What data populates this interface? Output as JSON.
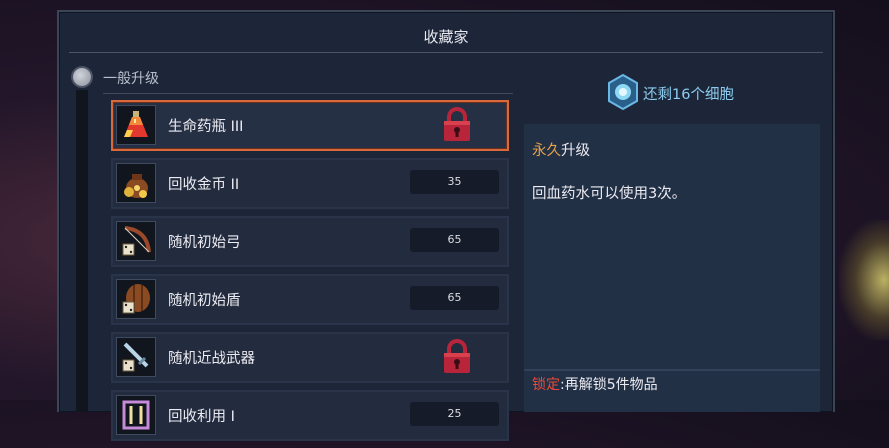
{
  "window": {
    "title": "收藏家"
  },
  "section": {
    "label": "一般升级"
  },
  "items": [
    {
      "name": "生命药瓶 III",
      "icon": "health-flask-icon",
      "locked": true,
      "cost": null,
      "selected": true
    },
    {
      "name": "回收金币 II",
      "icon": "gold-bag-icon",
      "locked": false,
      "cost": "35",
      "selected": false
    },
    {
      "name": "随机初始弓",
      "icon": "bow-dice-icon",
      "locked": false,
      "cost": "65",
      "selected": false
    },
    {
      "name": "随机初始盾",
      "icon": "shield-dice-icon",
      "locked": false,
      "cost": "65",
      "selected": false
    },
    {
      "name": "随机近战武器",
      "icon": "sword-dice-icon",
      "locked": true,
      "cost": null,
      "selected": false
    },
    {
      "name": "回收利用 I",
      "icon": "recycle-icon",
      "locked": false,
      "cost": "25",
      "selected": false
    }
  ],
  "cells": {
    "text": "还剩16个细胞",
    "icon": "cell-icon"
  },
  "detail": {
    "permanent_prefix": "永久",
    "permanent_rest": "升级",
    "description": "回血药水可以使用3次。",
    "lock_prefix": "锁定",
    "lock_rest": ":再解锁5件物品"
  },
  "colors": {
    "selected_border": "#d9683a",
    "lock_red": "#b8243a",
    "cells_blue": "#8ccdf0",
    "permanent_orange": "#e6a24a"
  }
}
